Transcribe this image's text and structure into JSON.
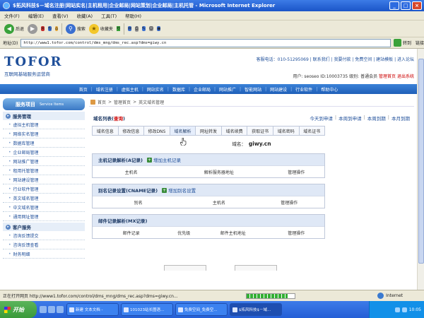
{
  "window": {
    "title": "$拓风科技$－域名注册|网站实名|主机租用|企业邮局|网站策划|企业邮局|主机托管 - Microsoft Internet Explorer",
    "controls": [
      "_",
      "□",
      "×"
    ]
  },
  "menu": [
    "文件(F)",
    "编辑(E)",
    "查看(V)",
    "收藏(A)",
    "工具(T)",
    "帮助(H)"
  ],
  "toolbar": {
    "back": "后退",
    "search": "搜索",
    "favorites": "收藏夹"
  },
  "address": {
    "label": "地址(D)",
    "url": "http://www1.tofor.com/control/dms_mng/dms_rec.asp?dms=giwy.cn",
    "go": "转到",
    "links": "链接"
  },
  "site": {
    "logo": "TOFOR",
    "logo_sub": "互联网基础服务运营商",
    "top_links": "客服电话：010-51295069 | 联系我们 | 我要付款 | 免费空间 | 建站模板 | 进入论坛",
    "user_prefix": "用户:",
    "user_id": "seoseo",
    "user_mid": "ID:10003735 级别:",
    "user_level": "普通会员",
    "admin_home": "管理首页",
    "logout": "退出系统"
  },
  "nav": [
    "首页",
    "域名注册",
    "虚拟主机",
    "网站实名",
    "数据库",
    "企业邮局",
    "网站推广",
    "智能网站",
    "网站建设",
    "行业软件",
    "帮助中心"
  ],
  "sidebar": {
    "header": "服务项目",
    "header_en": "Service Items",
    "cat1": "服务管理",
    "items1": [
      "虚拟主机管理",
      "网络实名管理",
      "数据库管理",
      "企业邮局管理",
      "网站推广管理",
      "租用托管管理",
      "网站建设管理",
      "行业软件管理",
      "英文域名管理",
      "中文域名管理",
      "通用网址管理"
    ],
    "cat2": "客户服务",
    "items2": [
      "咨询反馈提交",
      "咨询反馈查看",
      "财务明细"
    ]
  },
  "breadcrumb": [
    "首页",
    "管理首页",
    "英文域名管理"
  ],
  "list": {
    "title": "域名列表",
    "query": "查询",
    "quick": [
      "今天到申请",
      "本周到申请",
      "本周到期",
      "本月到期"
    ]
  },
  "tabs": [
    "域名信息",
    "修改信息",
    "修改DNS",
    "域名解析",
    "网址转发",
    "域名续费",
    "获取证书",
    "域名密码",
    "域名证书"
  ],
  "domain": {
    "label": "域名：",
    "value": "giwy.cn"
  },
  "sections": [
    {
      "title": "主机记录解析(A记录)",
      "add": "增加主机记录",
      "cols": [
        "主机名",
        "解析服务器地址",
        "管理操作"
      ]
    },
    {
      "title": "别名记录设置(CNAME记录)",
      "add": "增加别名设置",
      "cols": [
        "别名",
        "主机名",
        "管理操作"
      ]
    },
    {
      "title": "邮件记录解析(MX记录)",
      "add": "",
      "cols": [
        "邮件记录",
        "优先级",
        "邮件主机地址",
        "管理操作"
      ]
    }
  ],
  "status": {
    "text": "正在打开网页 http://www1.tofor.com/control/dms_mng/dms_rec.asp?dms=giwy.cn...",
    "progress": 0.85,
    "zone": "Internet"
  },
  "taskbar": {
    "start": "开始",
    "tasks": [
      "新建 文本文档 -",
      "101023站长图语...",
      "免费空间_免费空...",
      "$拓风科技$－域..."
    ],
    "clock": "10:05"
  },
  "colors": {
    "titlebar": "#1b55c8",
    "nav": "#1f5fb8",
    "accent_red": "#c00000",
    "link": "#1f4f9a"
  }
}
